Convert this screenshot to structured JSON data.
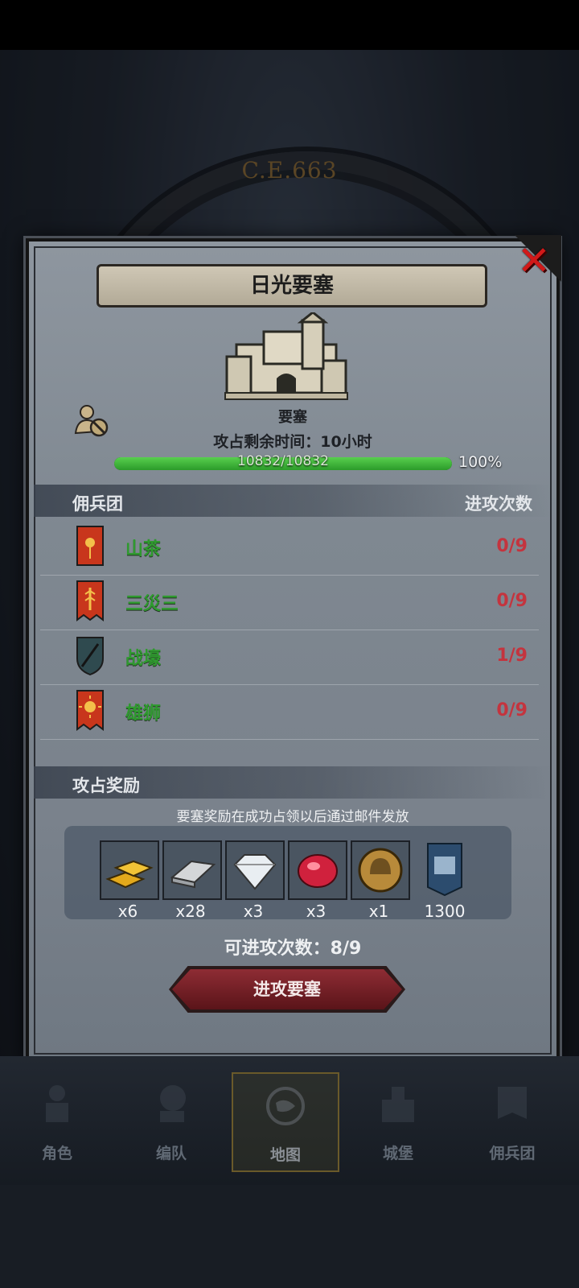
{
  "background": {
    "era_label": "C.E.663"
  },
  "modal": {
    "title": "日光要塞",
    "close_icon": "close-x-icon",
    "castle_name": "要塞",
    "timer_text": "攻占剩余时间：10小时",
    "progress": {
      "text": "10832/10832",
      "percent_text": "100%",
      "fraction": 1.0
    },
    "mercenary_header": {
      "left": "佣兵团",
      "right": "进攻次数"
    },
    "mercenaries": [
      {
        "name": "山茶",
        "count": "0/9",
        "banner_color": "#c8361c",
        "icon": "flower-banner-icon"
      },
      {
        "name": "三災三",
        "count": "0/9",
        "banner_color": "#c8361c",
        "icon": "wheat-banner-icon"
      },
      {
        "name": "战壕",
        "count": "1/9",
        "banner_color": "#2f4a4f",
        "icon": "sword-shield-icon"
      },
      {
        "name": "雄狮",
        "count": "0/9",
        "banner_color": "#c8361c",
        "icon": "sun-banner-icon"
      }
    ],
    "reward_header": "攻占奖励",
    "reward_note": "要塞奖励在成功占领以后通过邮件发放",
    "rewards": [
      {
        "icon": "gold-bars-icon",
        "qty": "x6"
      },
      {
        "icon": "iron-ingot-icon",
        "qty": "x28"
      },
      {
        "icon": "diamond-icon",
        "qty": "x3"
      },
      {
        "icon": "ruby-icon",
        "qty": "x3"
      },
      {
        "icon": "helmet-coin-icon",
        "qty": "x1"
      },
      {
        "icon": "fortress-banner-icon",
        "qty": "1300"
      }
    ],
    "attempts_text": "可进攻次数：8/9",
    "attack_button": "进攻要塞"
  },
  "nav": {
    "items": [
      {
        "label": "角色",
        "icon": "character-icon"
      },
      {
        "label": "编队",
        "icon": "formation-icon"
      },
      {
        "label": "地图",
        "icon": "map-icon",
        "active": true
      },
      {
        "label": "城堡",
        "icon": "castle-icon"
      },
      {
        "label": "佣兵团",
        "icon": "mercenary-icon"
      }
    ]
  },
  "colors": {
    "name_green": "#2f9a2f",
    "count_red": "#c4343e",
    "progress_green": "#3fb53a",
    "close_red": "#d11919"
  }
}
